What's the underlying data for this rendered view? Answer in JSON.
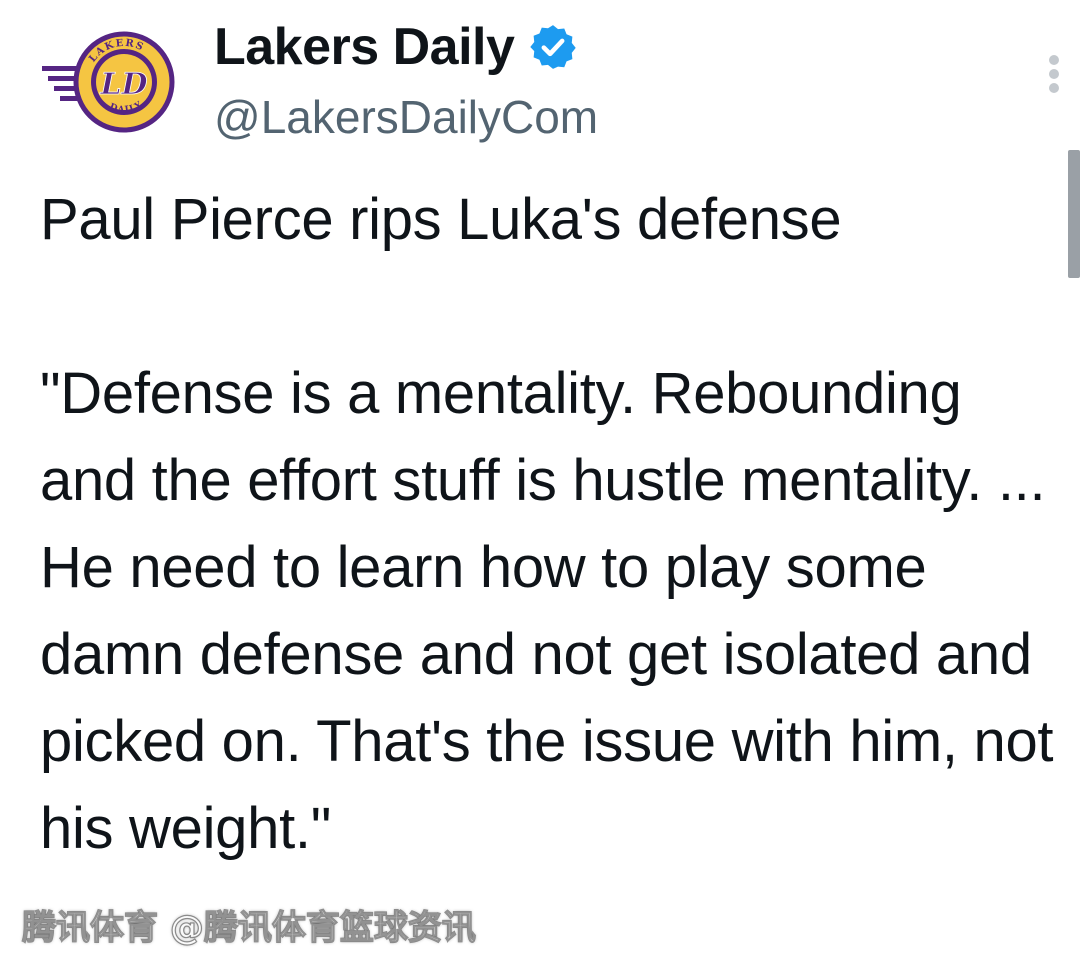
{
  "account": {
    "display_name": "Lakers Daily",
    "handle": "@LakersDailyCom",
    "verified": true,
    "avatar_logo_text": "LAKERS DAILY",
    "avatar_monogram": "LD"
  },
  "tweet": {
    "text": "Paul Pierce rips Luka's defense\n\n\"Defense is a mentality. Rebounding and the effort stuff is hustle mentality. ... He need to learn how to play some damn defense and not get isolated and picked on. That's the issue with him, not his weight.\""
  },
  "watermark": {
    "text": "腾讯体育 @腾讯体育篮球资讯"
  },
  "icons": {
    "verified": "verified-badge-icon",
    "more": "more-vertical-icon"
  },
  "colors": {
    "verified_blue": "#1d9bf0",
    "handle_gray": "#536471",
    "text": "#0f1419",
    "logo_purple": "#552583",
    "logo_gold": "#f5c542"
  }
}
